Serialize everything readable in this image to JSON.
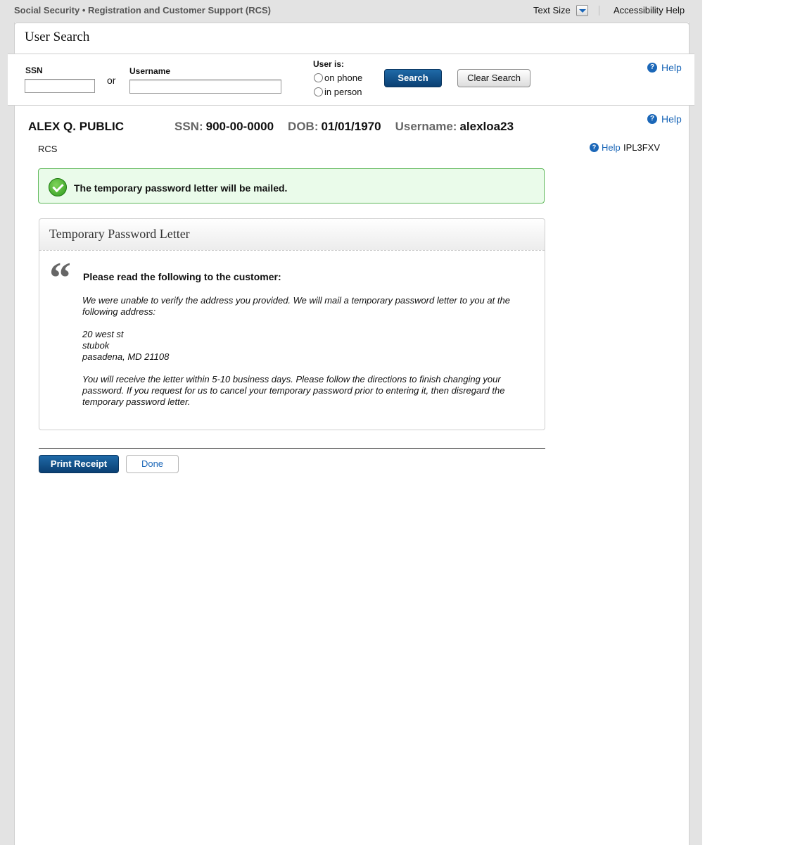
{
  "topbar": {
    "app_title": "Social Security • Registration and Customer Support (RCS)",
    "text_size_label": "Text Size",
    "accessibility_help": "Accessibility Help"
  },
  "search": {
    "title": "User Search",
    "ssn_label": "SSN",
    "ssn_value": "",
    "or_label": "or",
    "username_label": "Username",
    "username_value": "",
    "user_is_label": "User is:",
    "radio_phone": "on phone",
    "radio_person": "in person",
    "search_button": "Search",
    "clear_button": "Clear Search",
    "help_label": "Help"
  },
  "user": {
    "name": "ALEX Q. PUBLIC",
    "ssn_label": "SSN:",
    "ssn": "900-00-0000",
    "dob_label": "DOB:",
    "dob": "01/01/1970",
    "username_label": "Username:",
    "username": "alexloa23",
    "help_label": "Help"
  },
  "context": {
    "system": "RCS",
    "help_label": "Help",
    "code": "IPL3FXV"
  },
  "success_message": "The temporary password letter will be mailed.",
  "letter": {
    "title": "Temporary Password Letter",
    "quote_glyph": "“",
    "instruction": "Please read the following to the customer:",
    "paragraph1": "We were unable to verify the address you provided. We will mail a temporary password letter to you at the following address:",
    "address_line1": "20 west st",
    "address_line2": "stubok",
    "address_line3": "pasadena, MD 21108",
    "paragraph2": "You will receive the letter within 5-10 business days. Please follow the directions to finish changing your password. If you request for us to cancel your temporary password prior to entering it, then disregard the temporary password letter."
  },
  "actions": {
    "print_receipt": "Print Receipt",
    "done": "Done"
  },
  "colors": {
    "primary_button": "#0a3f72",
    "link": "#1b67b8",
    "success_border": "#5fb85a",
    "success_bg": "#eafbea"
  },
  "icons": {
    "help": "question-circle-icon",
    "success": "check-circle-icon",
    "text_size": "chevron-down-icon",
    "quote": "quote-icon"
  }
}
